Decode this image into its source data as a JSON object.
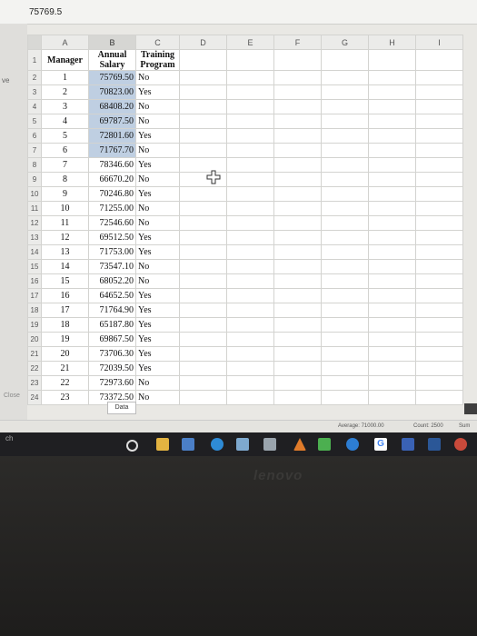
{
  "formula_bar": {
    "value": "75769.5"
  },
  "left_strip": {
    "label_top": "ve",
    "label_bottom": "ch",
    "close_label": "Close"
  },
  "columns": [
    "A",
    "B",
    "C",
    "D",
    "E",
    "F",
    "G",
    "H",
    "I"
  ],
  "selected_column": "B",
  "header_row": {
    "row_num": "1",
    "manager": "Manager",
    "salary": "Annual Salary",
    "training": "Training Program"
  },
  "rows": [
    {
      "row": "2",
      "manager": "1",
      "salary": "75769.50",
      "training": "No"
    },
    {
      "row": "3",
      "manager": "2",
      "salary": "70823.00",
      "training": "Yes"
    },
    {
      "row": "4",
      "manager": "3",
      "salary": "68408.20",
      "training": "No"
    },
    {
      "row": "5",
      "manager": "4",
      "salary": "69787.50",
      "training": "No"
    },
    {
      "row": "6",
      "manager": "5",
      "salary": "72801.60",
      "training": "Yes"
    },
    {
      "row": "7",
      "manager": "6",
      "salary": "71767.70",
      "training": "No"
    },
    {
      "row": "8",
      "manager": "7",
      "salary": "78346.60",
      "training": "Yes"
    },
    {
      "row": "9",
      "manager": "8",
      "salary": "66670.20",
      "training": "No"
    },
    {
      "row": "10",
      "manager": "9",
      "salary": "70246.80",
      "training": "Yes"
    },
    {
      "row": "11",
      "manager": "10",
      "salary": "71255.00",
      "training": "No"
    },
    {
      "row": "12",
      "manager": "11",
      "salary": "72546.60",
      "training": "No"
    },
    {
      "row": "13",
      "manager": "12",
      "salary": "69512.50",
      "training": "Yes"
    },
    {
      "row": "14",
      "manager": "13",
      "salary": "71753.00",
      "training": "Yes"
    },
    {
      "row": "15",
      "manager": "14",
      "salary": "73547.10",
      "training": "No"
    },
    {
      "row": "16",
      "manager": "15",
      "salary": "68052.20",
      "training": "No"
    },
    {
      "row": "17",
      "manager": "16",
      "salary": "64652.50",
      "training": "Yes"
    },
    {
      "row": "18",
      "manager": "17",
      "salary": "71764.90",
      "training": "Yes"
    },
    {
      "row": "19",
      "manager": "18",
      "salary": "65187.80",
      "training": "Yes"
    },
    {
      "row": "20",
      "manager": "19",
      "salary": "69867.50",
      "training": "Yes"
    },
    {
      "row": "21",
      "manager": "20",
      "salary": "73706.30",
      "training": "Yes"
    },
    {
      "row": "22",
      "manager": "21",
      "salary": "72039.50",
      "training": "Yes"
    },
    {
      "row": "23",
      "manager": "22",
      "salary": "72973.60",
      "training": "No"
    },
    {
      "row": "24",
      "manager": "23",
      "salary": "73372.50",
      "training": "No"
    }
  ],
  "highlighted_rows": 6,
  "sheet_tab": "Data",
  "status": {
    "average": "Average: 71000.00",
    "count": "Count: 2500",
    "sum": "Sum"
  },
  "taskbar_icons": [
    "cortana-icon",
    "file-explorer-icon",
    "mail-icon",
    "edge-icon",
    "photos-icon",
    "store-icon",
    "upload-icon",
    "app-icon",
    "dots-icon",
    "google-icon",
    "media-icon",
    "word-icon",
    "chrome-icon"
  ],
  "brand": "lenovo",
  "colors": {
    "selection": "#bfcfe2",
    "header_bg": "#ebebe9"
  }
}
